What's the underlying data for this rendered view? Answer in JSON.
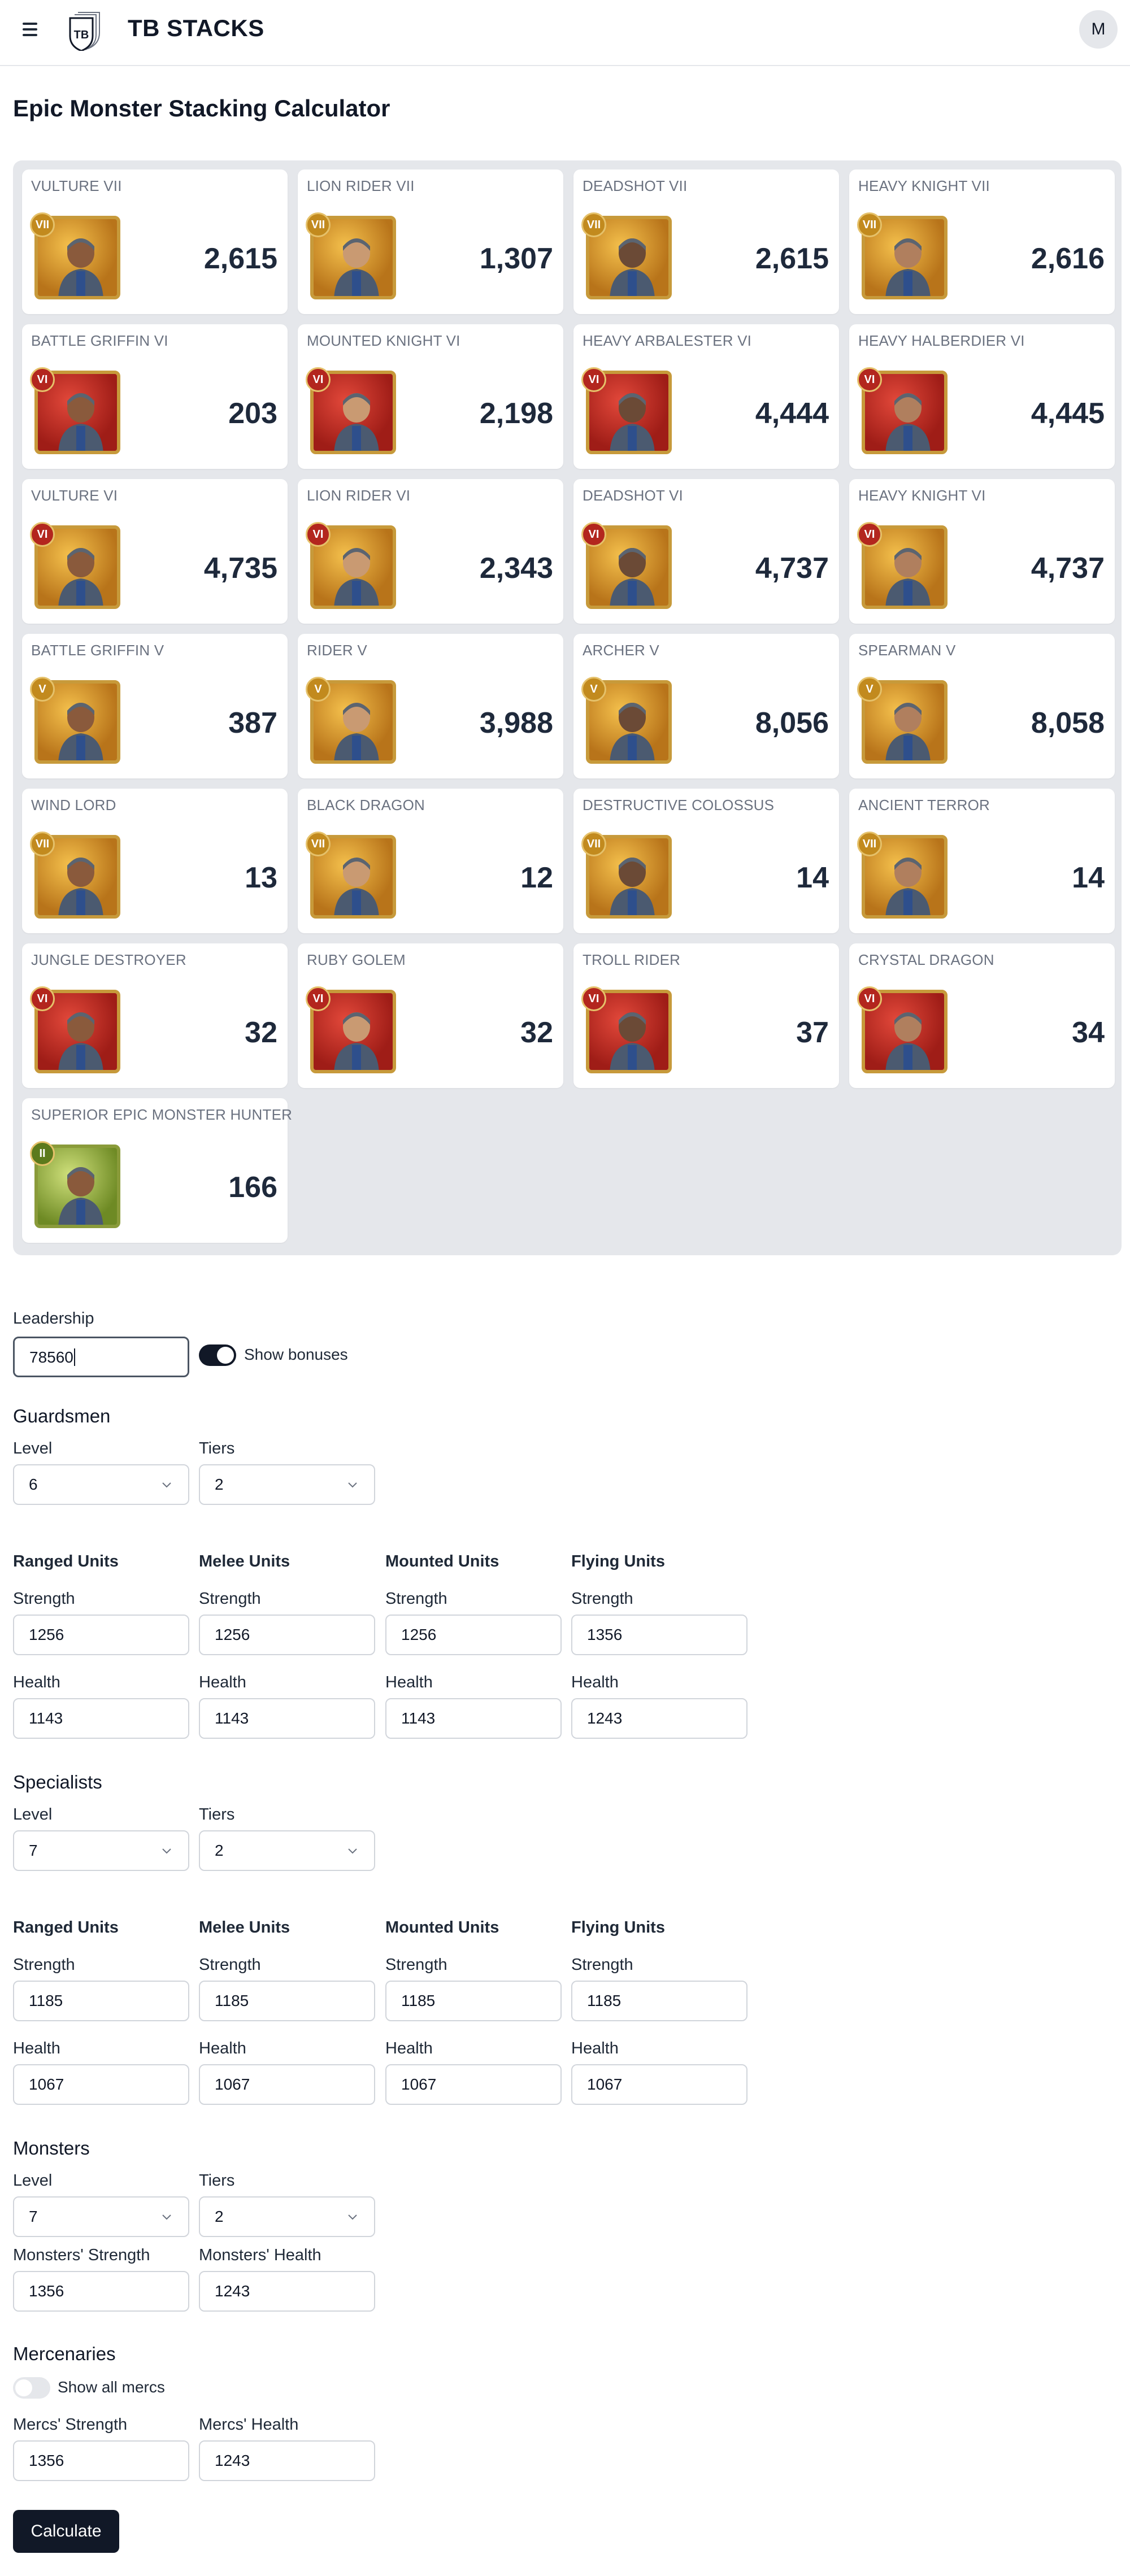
{
  "header": {
    "brand": "TB STACKS",
    "logo_text": "TB",
    "avatar_initial": "M"
  },
  "page_title": "Epic Monster Stacking Calculator",
  "colors": {
    "accent": "#111827",
    "panel": "#e5e7eb",
    "card_count": "#1e293b",
    "frame_gold": "#c79a3b"
  },
  "cards": [
    {
      "name": "VULTURE VII",
      "tier": "VII",
      "count": "2,615",
      "frame": "gold"
    },
    {
      "name": "LION RIDER VII",
      "tier": "VII",
      "count": "1,307",
      "frame": "gold"
    },
    {
      "name": "DEADSHOT VII",
      "tier": "VII",
      "count": "2,615",
      "frame": "gold"
    },
    {
      "name": "HEAVY KNIGHT VII",
      "tier": "VII",
      "count": "2,616",
      "frame": "gold"
    },
    {
      "name": "BATTLE GRIFFIN VI",
      "tier": "VI",
      "count": "203",
      "frame": "red"
    },
    {
      "name": "MOUNTED KNIGHT VI",
      "tier": "VI",
      "count": "2,198",
      "frame": "red"
    },
    {
      "name": "HEAVY ARBALESTER VI",
      "tier": "VI",
      "count": "4,444",
      "frame": "red"
    },
    {
      "name": "HEAVY HALBERDIER VI",
      "tier": "VI",
      "count": "4,445",
      "frame": "red"
    },
    {
      "name": "VULTURE VI",
      "tier": "VI",
      "count": "4,735",
      "frame": "gold"
    },
    {
      "name": "LION RIDER VI",
      "tier": "VI",
      "count": "2,343",
      "frame": "gold"
    },
    {
      "name": "DEADSHOT VI",
      "tier": "VI",
      "count": "4,737",
      "frame": "gold"
    },
    {
      "name": "HEAVY KNIGHT VI",
      "tier": "VI",
      "count": "4,737",
      "frame": "gold"
    },
    {
      "name": "BATTLE GRIFFIN V",
      "tier": "V",
      "count": "387",
      "frame": "gold"
    },
    {
      "name": "RIDER V",
      "tier": "V",
      "count": "3,988",
      "frame": "gold"
    },
    {
      "name": "ARCHER V",
      "tier": "V",
      "count": "8,056",
      "frame": "gold"
    },
    {
      "name": "SPEARMAN V",
      "tier": "V",
      "count": "8,058",
      "frame": "gold"
    },
    {
      "name": "WIND LORD",
      "tier": "VII",
      "count": "13",
      "frame": "gold"
    },
    {
      "name": "BLACK DRAGON",
      "tier": "VII",
      "count": "12",
      "frame": "gold"
    },
    {
      "name": "DESTRUCTIVE COLOSSUS",
      "tier": "VII",
      "count": "14",
      "frame": "gold"
    },
    {
      "name": "ANCIENT TERROR",
      "tier": "VII",
      "count": "14",
      "frame": "gold"
    },
    {
      "name": "JUNGLE DESTROYER",
      "tier": "VI",
      "count": "32",
      "frame": "red"
    },
    {
      "name": "RUBY GOLEM",
      "tier": "VI",
      "count": "32",
      "frame": "red"
    },
    {
      "name": "TROLL RIDER",
      "tier": "VI",
      "count": "37",
      "frame": "red"
    },
    {
      "name": "CRYSTAL DRAGON",
      "tier": "VI",
      "count": "34",
      "frame": "red"
    },
    {
      "name": "SUPERIOR EPIC MONSTER HUNTER",
      "tier": "II",
      "count": "166",
      "frame": "green"
    }
  ],
  "leadership": {
    "label": "Leadership",
    "value": "78560",
    "show_bonuses_label": "Show bonuses",
    "show_bonuses": true
  },
  "common": {
    "level": "Level",
    "tiers": "Tiers",
    "strength": "Strength",
    "health": "Health",
    "ranged": "Ranged Units",
    "melee": "Melee Units",
    "mounted": "Mounted Units",
    "flying": "Flying Units"
  },
  "guardsmen": {
    "title": "Guardsmen",
    "level": "6",
    "tiers": "2",
    "strength": [
      "1256",
      "1256",
      "1256",
      "1356"
    ],
    "health": [
      "1143",
      "1143",
      "1143",
      "1243"
    ]
  },
  "specialists": {
    "title": "Specialists",
    "level": "7",
    "tiers": "2",
    "strength": [
      "1185",
      "1185",
      "1185",
      "1185"
    ],
    "health": [
      "1067",
      "1067",
      "1067",
      "1067"
    ]
  },
  "monsters": {
    "title": "Monsters",
    "level": "7",
    "tiers": "2",
    "strength_label": "Monsters' Strength",
    "health_label": "Monsters' Health",
    "strength": "1356",
    "health": "1243"
  },
  "mercenaries": {
    "title": "Mercenaries",
    "show_all_label": "Show all mercs",
    "show_all": false,
    "strength_label": "Mercs' Strength",
    "health_label": "Mercs' Health",
    "strength": "1356",
    "health": "1243"
  },
  "calculate_label": "Calculate"
}
